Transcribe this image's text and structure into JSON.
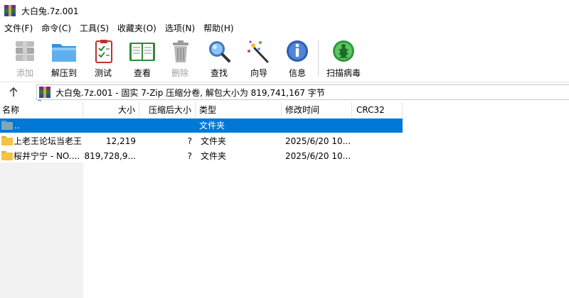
{
  "window": {
    "title": "大白兔.7z.001"
  },
  "menu": [
    "文件(F)",
    "命令(C)",
    "工具(S)",
    "收藏夹(O)",
    "选项(N)",
    "帮助(H)"
  ],
  "toolbar": [
    {
      "label": "添加",
      "icon": "add-archive-icon",
      "enabled": false
    },
    {
      "label": "解压到",
      "icon": "extract-to-icon",
      "enabled": true
    },
    {
      "label": "测试",
      "icon": "test-icon",
      "enabled": true
    },
    {
      "label": "查看",
      "icon": "view-icon",
      "enabled": true
    },
    {
      "label": "删除",
      "icon": "delete-icon",
      "enabled": false
    },
    {
      "label": "查找",
      "icon": "find-icon",
      "enabled": true
    },
    {
      "label": "向导",
      "icon": "wizard-icon",
      "enabled": true
    },
    {
      "label": "信息",
      "icon": "info-icon",
      "enabled": true
    },
    {
      "label": "扫描病毒",
      "icon": "virus-scan-icon",
      "enabled": true
    }
  ],
  "address": {
    "up_icon": "up-arrow-icon",
    "path": "大白兔.7z.001 - 固实 7-Zip 压缩分卷, 解包大小为 819,741,167 字节"
  },
  "columns": [
    "名称",
    "大小",
    "压缩后大小",
    "类型",
    "修改时间",
    "CRC32"
  ],
  "sort_indicator": "^",
  "rows": [
    {
      "name": "..",
      "size": "",
      "packed": "",
      "type": "文件夹",
      "modified": "",
      "crc": "",
      "selected": true,
      "folder_color": "#7fa9b8"
    },
    {
      "name": "上老王论坛当老王",
      "size": "12,219",
      "packed": "?",
      "type": "文件夹",
      "modified": "2025/6/20 10...",
      "crc": "",
      "selected": false,
      "folder_color": "#f5c342"
    },
    {
      "name": "桜井宁宁 - NO....",
      "size": "819,728,9...",
      "packed": "?",
      "type": "文件夹",
      "modified": "2025/6/20 10...",
      "crc": "",
      "selected": false,
      "folder_color": "#f5c342"
    }
  ],
  "colors": {
    "selection": "#0078d7",
    "folder": "#f5c342"
  }
}
